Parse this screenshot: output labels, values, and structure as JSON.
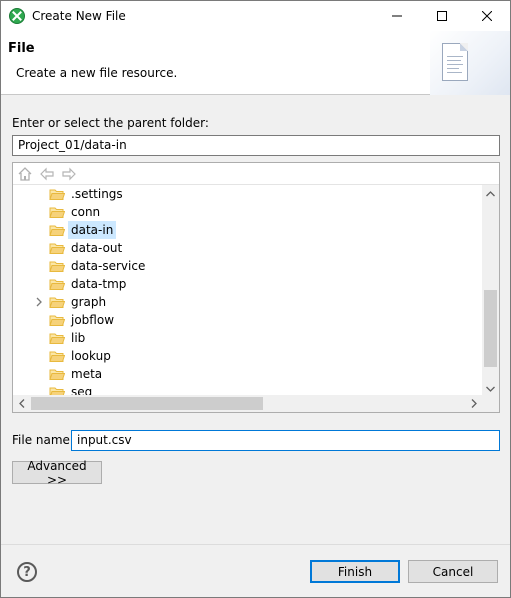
{
  "window": {
    "title": "Create New File",
    "controls": {
      "minimize_icon": "minimize-icon",
      "maximize_icon": "maximize-icon",
      "close_icon": "close-icon"
    }
  },
  "banner": {
    "title": "File",
    "description": "Create a new file resource."
  },
  "parent_folder": {
    "label": "Enter or select the parent folder:",
    "value": "Project_01/data-in"
  },
  "tree": {
    "toolbar": [
      "home-icon",
      "back-icon",
      "forward-icon"
    ],
    "items": [
      {
        "label": ".settings",
        "expandable": false,
        "selected": false
      },
      {
        "label": "conn",
        "expandable": false,
        "selected": false
      },
      {
        "label": "data-in",
        "expandable": false,
        "selected": true
      },
      {
        "label": "data-out",
        "expandable": false,
        "selected": false
      },
      {
        "label": "data-service",
        "expandable": false,
        "selected": false
      },
      {
        "label": "data-tmp",
        "expandable": false,
        "selected": false
      },
      {
        "label": "graph",
        "expandable": true,
        "selected": false
      },
      {
        "label": "jobflow",
        "expandable": false,
        "selected": false
      },
      {
        "label": "lib",
        "expandable": false,
        "selected": false
      },
      {
        "label": "lookup",
        "expandable": false,
        "selected": false
      },
      {
        "label": "meta",
        "expandable": false,
        "selected": false
      },
      {
        "label": "seq",
        "expandable": false,
        "selected": false
      }
    ]
  },
  "file_name": {
    "label": "File name:",
    "value": "input.csv"
  },
  "buttons": {
    "advanced": "Advanced >>",
    "finish": "Finish",
    "cancel": "Cancel"
  },
  "colors": {
    "accent": "#0078d7",
    "selection": "#cce8ff",
    "folder": "#e8b93e"
  }
}
